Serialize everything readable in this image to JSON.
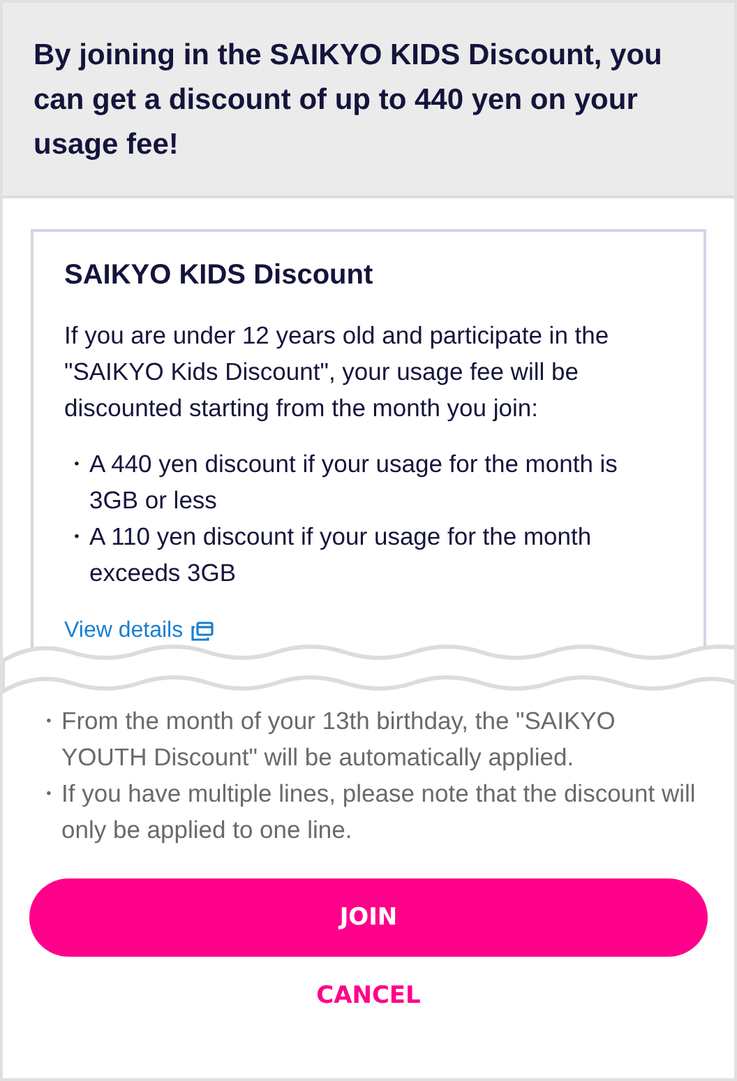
{
  "header": {
    "title": "By joining in the SAIKYO KIDS Discount, you can get a discount of up to 440 yen on your usage fee!"
  },
  "card": {
    "title": "SAIKYO KIDS Discount",
    "intro": "If you are under 12 years old and participate in the \"SAIKYO Kids Discount\", your usage fee will be discounted starting from the month you join:",
    "items": [
      {
        "bullet": "・",
        "text": "A 440 yen discount if your usage for the month is 3GB or less"
      },
      {
        "bullet": "・",
        "text": "A 110 yen discount if your usage for the month exceeds 3GB"
      }
    ],
    "link": "View details"
  },
  "notes": [
    {
      "bullet": "・",
      "text": "From the month of your 13th birthday, the \"SAIKYO YOUTH Discount\" will be automatically applied."
    },
    {
      "bullet": "・",
      "text": "If you have multiple lines, please note that the discount will only be applied to one line."
    }
  ],
  "buttons": [
    {
      "kind": "primary",
      "label": "JOIN"
    },
    {
      "kind": "text",
      "label": "CANCEL"
    }
  ]
}
